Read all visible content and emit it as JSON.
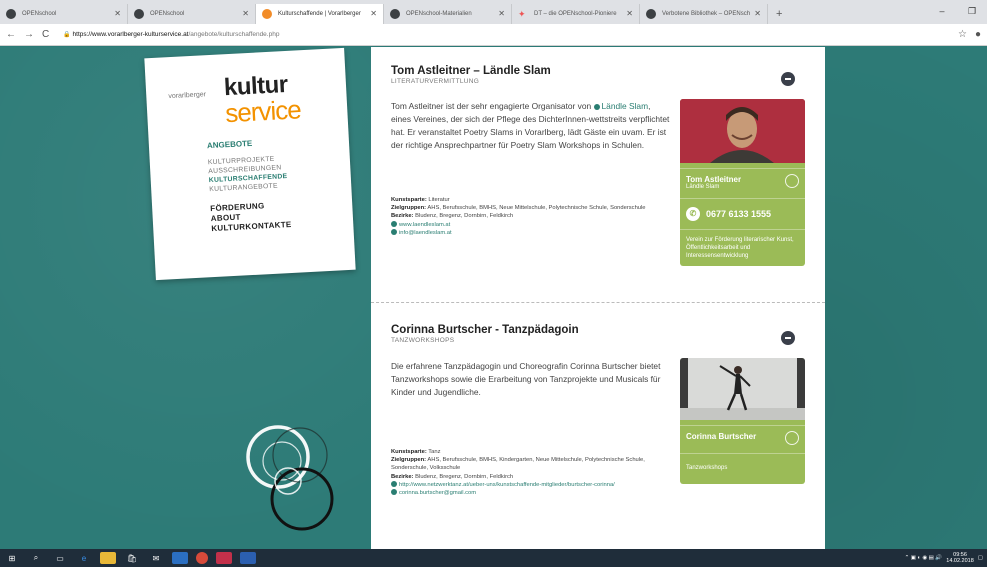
{
  "tabs": [
    {
      "title": "OPENschool",
      "icon": "github-icon",
      "active": false
    },
    {
      "title": "OPENschool",
      "icon": "github-icon",
      "active": false
    },
    {
      "title": "Kulturschaffende | Vorarlberger",
      "icon": "kultur-icon",
      "active": true
    },
    {
      "title": "OPENschool-Materialien",
      "icon": "github-icon",
      "active": false
    },
    {
      "title": "DT – die OPENschool-Pioniere",
      "icon": "star-icon",
      "active": false
    },
    {
      "title": "Verbotene Bibliothek – OPENsch",
      "icon": "github-icon",
      "active": false
    }
  ],
  "browser": {
    "new_tab": "+",
    "minimize": "–",
    "maximize": "❐",
    "back": "←",
    "forward": "→",
    "reload": "C",
    "url_host": "https://www.vorarlberger-kulturservice.at",
    "url_path": "/angebote/kulturschaffende.php",
    "star": "☆",
    "account": "●"
  },
  "site": {
    "logo_small": "vorarlberger",
    "logo_main": "kultur",
    "logo_service": "service",
    "nav": {
      "section": "ANGEBOTE",
      "sub": [
        "KULTURPROJEKTE",
        "AUSSCHREIBUNGEN",
        "KULTURSCHAFFENDE",
        "KULTURANGEBOTE"
      ],
      "active_sub": "KULTURSCHAFFENDE",
      "main": [
        "FÖRDERUNG",
        "ABOUT",
        "KULTURKONTAKTE"
      ]
    }
  },
  "entries": [
    {
      "name": "Tom Astleitner – Ländle Slam",
      "category": "LITERATURVERMITTLUNG",
      "desc_pre": "Tom Astleitner ist der sehr engagierte Organisator von ",
      "desc_link": "Ländle Slam",
      "desc_post": ", eines Vereines, der sich der Pflege des DichterInnen-wettstreits verpflichtet hat. Er veranstaltet Poetry Slams in Vorarlberg, lädt Gäste ein uvam. Er ist der richtige Ansprechpartner für Poetry Slam Workshops in Schulen.",
      "meta": [
        {
          "label": "Kunstsparte:",
          "value": " Literatur"
        },
        {
          "label": "Zielgruppen:",
          "value": " AHS, Berufsschule, BMHS, Neue Mittelschule, Polytechnische Schule, Sonderschule"
        },
        {
          "label": "Bezirke:",
          "value": " Bludenz, Bregenz, Dornbirn, Feldkirch"
        }
      ],
      "links": [
        "www.laendleslam.at",
        "info@laendleslam.at"
      ],
      "card": {
        "name": "Tom Astleitner",
        "org": "Ländle Slam",
        "phone": "0677 6133 1555",
        "desc": "Verein zur Förderung literarischer Kunst, Öffentlichkeitsarbeit und Interessensentwicklung"
      }
    },
    {
      "name": "Corinna Burtscher - Tanzpädagoin",
      "category": "TANZWORKSHOPS",
      "desc_pre": "Die erfahrene Tanzpädagogin und Choreografin Corinna Burtscher bietet Tanzworkshops sowie die Erarbeitung von Tanzprojekte und Musicals für Kinder und Jugendliche.",
      "meta": [
        {
          "label": "Kunstsparte:",
          "value": " Tanz"
        },
        {
          "label": "Zielgruppen:",
          "value": " AHS, Berufsschule, BMHS, Kindergarten, Neue Mittelschule, Polytechnische Schule, Sonderschule, Volksschule"
        },
        {
          "label": "Bezirke:",
          "value": " Bludenz, Bregenz, Dornbirn, Feldkirch"
        }
      ],
      "links": [
        "http://www.netzwerktanz.at/ueber-uns/kunstschaffende-mitglieder/burtscher-corinna/",
        "corinna.burtscher@gmail.com"
      ],
      "card": {
        "name": "Corinna Burtscher",
        "desc": "Tanzworkshops"
      }
    }
  ],
  "taskbar": {
    "time": "09:56",
    "date": "14.02.2018"
  },
  "colors": {
    "teal": "#2b7a76",
    "accent": "#2a7e72",
    "orange": "#f39200",
    "card_green": "#9bbb57"
  }
}
